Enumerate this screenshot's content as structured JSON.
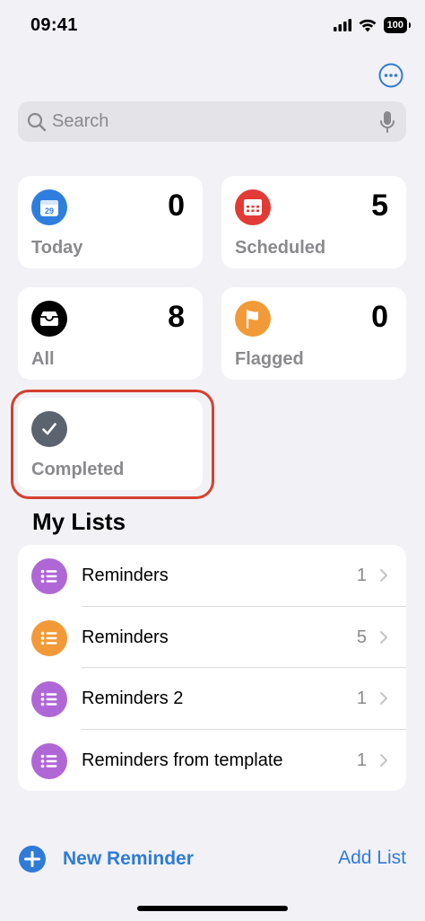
{
  "status_bar": {
    "time": "09:41",
    "battery": "100"
  },
  "search": {
    "placeholder": "Search"
  },
  "smart_lists": [
    {
      "label": "Today",
      "count": "0",
      "icon": "calendar-icon",
      "color": "#2e7ee0",
      "day": "29"
    },
    {
      "label": "Scheduled",
      "count": "5",
      "icon": "calendar-grid-icon",
      "color": "#e23b35"
    },
    {
      "label": "All",
      "count": "8",
      "icon": "tray-icon",
      "color": "#000000"
    },
    {
      "label": "Flagged",
      "count": "0",
      "icon": "flag-icon",
      "color": "#f19a37"
    },
    {
      "label": "Completed",
      "icon": "checkmark-icon",
      "color": "#5a636e"
    }
  ],
  "my_lists": {
    "title": "My Lists",
    "items": [
      {
        "name": "Reminders",
        "count": "1",
        "color": "#b067d6"
      },
      {
        "name": "Reminders",
        "count": "5",
        "color": "#f19a37"
      },
      {
        "name": "Reminders 2",
        "count": "1",
        "color": "#b067d6"
      },
      {
        "name": "Reminders from template",
        "count": "1",
        "color": "#b067d6"
      }
    ]
  },
  "toolbar": {
    "new_reminder": "New Reminder",
    "add_list": "Add List"
  },
  "colors": {
    "accent": "#2f7bd8",
    "highlight": "#d6402f",
    "background": "#f2f1f6"
  }
}
